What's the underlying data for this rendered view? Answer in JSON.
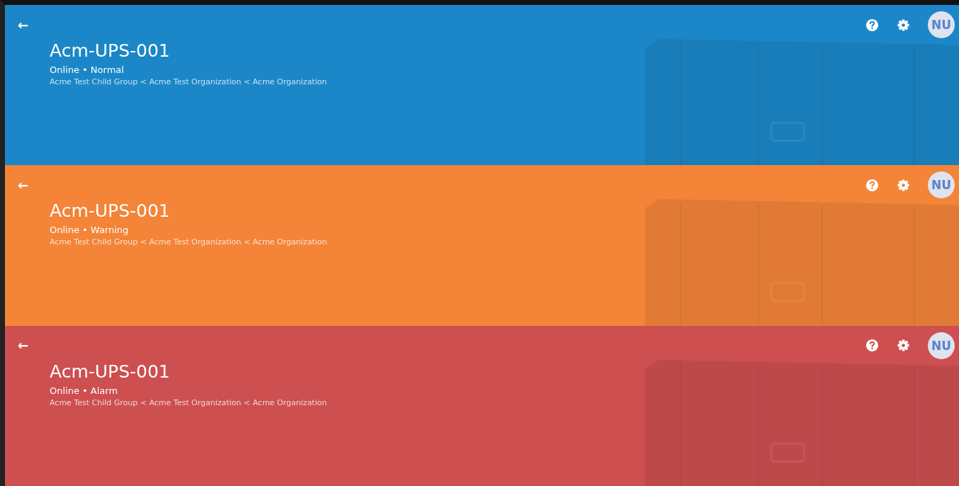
{
  "banners": [
    {
      "color": "#1b87c8",
      "back": "←",
      "title": "Acm-UPS-001",
      "status": "Online • Normal",
      "breadcrumb": "Acme Test Child Group < Acme Test Organization < Acme Organization",
      "avatar": "NU"
    },
    {
      "color": "#f38438",
      "back": "←",
      "title": "Acm-UPS-001",
      "status": "Online • Warning",
      "breadcrumb": "Acme Test Child Group < Acme Test Organization < Acme Organization",
      "avatar": "NU"
    },
    {
      "color": "#cd4f50",
      "back": "←",
      "title": "Acm-UPS-001",
      "status": "Online • Alarm",
      "breadcrumb": "Acme Test Child Group < Acme Test Organization < Acme Organization",
      "avatar": "NU"
    }
  ]
}
